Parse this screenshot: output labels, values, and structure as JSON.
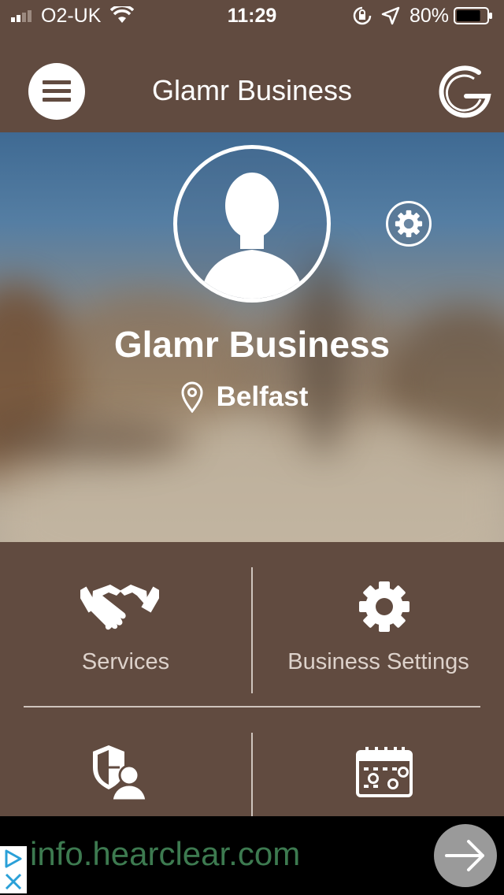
{
  "status_bar": {
    "carrier": "O2-UK",
    "time": "11:29",
    "battery_percent": "80%",
    "battery_level": 0.8,
    "icons": [
      "signal-icon",
      "wifi-icon",
      "orientation-lock-icon",
      "location-arrow-icon",
      "battery-icon"
    ]
  },
  "nav": {
    "title": "Glamr Business",
    "menu_icon": "hamburger-icon",
    "logo_icon": "glamr-logo"
  },
  "profile": {
    "name": "Glamr Business",
    "location": "Belfast",
    "avatar_icon": "avatar-placeholder-icon",
    "settings_icon": "gear-icon",
    "location_icon": "map-pin-icon"
  },
  "tiles": [
    {
      "label": "Services",
      "icon": "handshake-icon"
    },
    {
      "label": "Business Settings",
      "icon": "gear-icon"
    },
    {
      "label": "",
      "icon": "admin-shield-icon"
    },
    {
      "label": "",
      "icon": "calendar-icon"
    }
  ],
  "ad": {
    "text": "info.hearclear.com",
    "badge_icon": "ad-choices-icon",
    "action_icon": "arrow-right-icon"
  },
  "colors": {
    "brand_brown": "#614b40",
    "ad_green": "#3d7a50",
    "label_gray": "#ddd2cb"
  }
}
